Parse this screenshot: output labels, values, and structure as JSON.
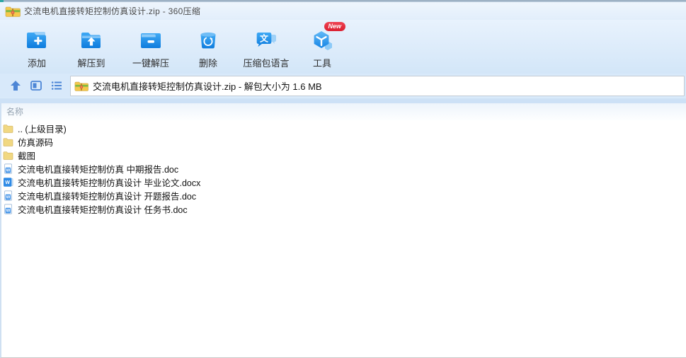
{
  "window": {
    "title": "交流电机直接转矩控制仿真设计.zip - 360压缩",
    "app_name": "360压缩",
    "app_icon": "zip-archive-icon"
  },
  "toolbar": {
    "buttons": [
      {
        "label": "添加",
        "icon": "add-folder-icon"
      },
      {
        "label": "解压到",
        "icon": "extract-to-icon"
      },
      {
        "label": "一键解压",
        "icon": "one-click-extract-icon"
      },
      {
        "label": "删除",
        "icon": "delete-trash-icon"
      },
      {
        "label": "压缩包语言",
        "icon": "archive-language-icon"
      },
      {
        "label": "工具",
        "icon": "tools-cube-icon",
        "badge": "New"
      }
    ]
  },
  "address_bar": {
    "nav_icons": [
      "up-icon",
      "preview-pane-icon",
      "list-view-icon"
    ],
    "file_icon": "zip-archive-icon",
    "value": "交流电机直接转矩控制仿真设计.zip - 解包大小为 1.6 MB"
  },
  "file_list": {
    "columns": [
      {
        "label": "名称"
      }
    ],
    "items": [
      {
        "name": ".. (上级目录)",
        "type": "folder",
        "icon": "folder-icon"
      },
      {
        "name": "仿真源码",
        "type": "folder",
        "icon": "folder-icon"
      },
      {
        "name": "截图",
        "type": "folder",
        "icon": "folder-icon"
      },
      {
        "name": "交流电机直接转矩控制仿真 中期报告.doc",
        "type": "doc",
        "icon": "word-doc-icon"
      },
      {
        "name": "交流电机直接转矩控制仿真设计 毕业论文.docx",
        "type": "docx",
        "icon": "word-docx-icon"
      },
      {
        "name": "交流电机直接转矩控制仿真设计 开题报告.doc",
        "type": "doc",
        "icon": "word-doc-icon"
      },
      {
        "name": "交流电机直接转矩控制仿真设计 任务书.doc",
        "type": "doc",
        "icon": "word-doc-icon"
      }
    ]
  },
  "colors": {
    "accent_blue": "#1b8cec",
    "accent_blue_light": "#8ecdf8",
    "toolbar_bg_top": "#e8f2fd",
    "toolbar_bg_bottom": "#d3e6f8",
    "address_row_bg": "#d8e9fa",
    "nav_icon_blue": "#4d86d6",
    "badge_red": "#da1f30",
    "folder_yellow": "#f1d882",
    "header_text_gray": "#96a4b2"
  }
}
